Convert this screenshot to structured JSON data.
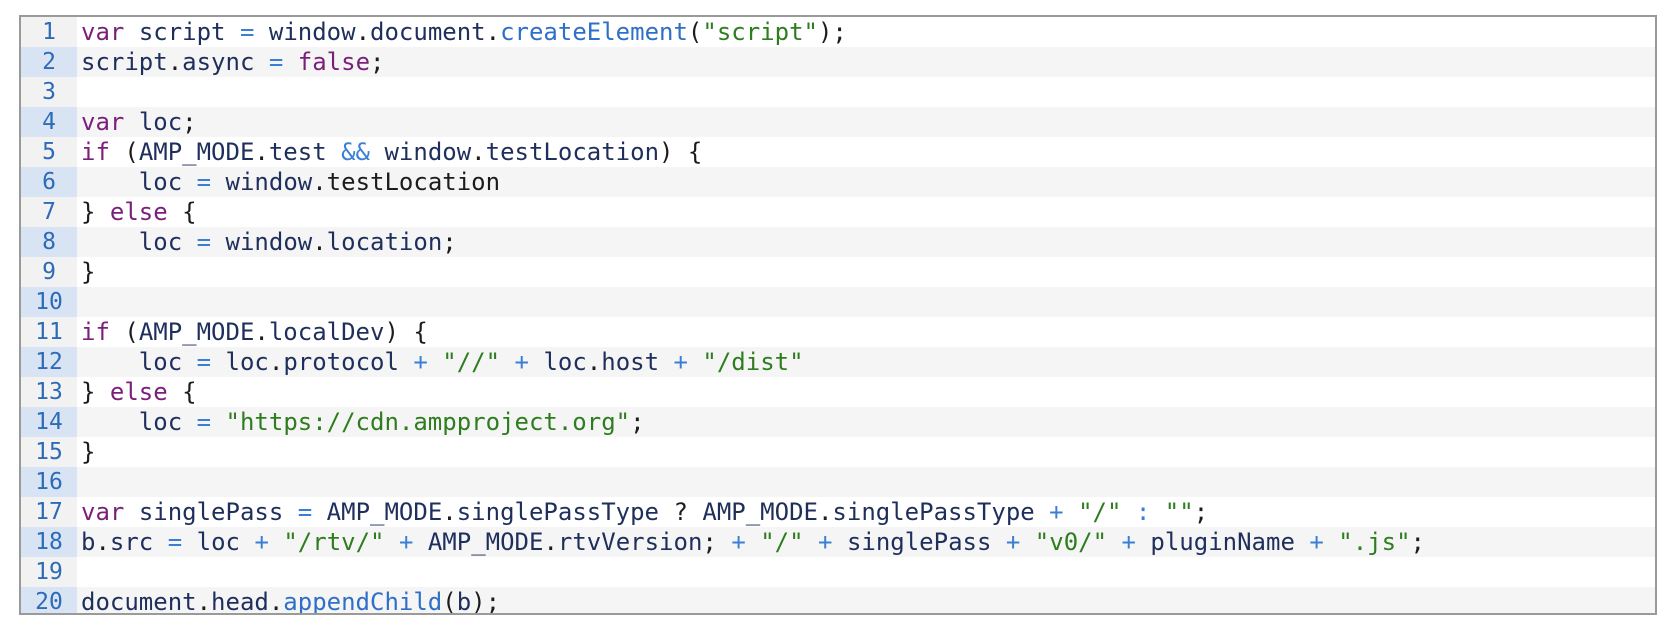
{
  "colors": {
    "keyword": "#7a1f7a",
    "identifier": "#1f2f5c",
    "string": "#2e7d1f",
    "operator": "#3b7fd4",
    "function": "#2f6fc8",
    "punctuation": "#1c1c1c",
    "line_number": "#2d6bb8"
  },
  "lines": [
    {
      "num": "1",
      "tokens": [
        {
          "t": "kw",
          "v": "var"
        },
        {
          "t": "ws",
          "v": " "
        },
        {
          "t": "id",
          "v": "script"
        },
        {
          "t": "ws",
          "v": " "
        },
        {
          "t": "op",
          "v": "="
        },
        {
          "t": "ws",
          "v": " "
        },
        {
          "t": "id",
          "v": "window"
        },
        {
          "t": "pn",
          "v": "."
        },
        {
          "t": "id",
          "v": "document"
        },
        {
          "t": "pn",
          "v": "."
        },
        {
          "t": "fn",
          "v": "createElement"
        },
        {
          "t": "pn",
          "v": "("
        },
        {
          "t": "str",
          "v": "\"script\""
        },
        {
          "t": "pn",
          "v": ");"
        }
      ]
    },
    {
      "num": "2",
      "tokens": [
        {
          "t": "id",
          "v": "script"
        },
        {
          "t": "pn",
          "v": "."
        },
        {
          "t": "id",
          "v": "async"
        },
        {
          "t": "ws",
          "v": " "
        },
        {
          "t": "op",
          "v": "="
        },
        {
          "t": "ws",
          "v": " "
        },
        {
          "t": "kw",
          "v": "false"
        },
        {
          "t": "pn",
          "v": ";"
        }
      ]
    },
    {
      "num": "3",
      "tokens": []
    },
    {
      "num": "4",
      "tokens": [
        {
          "t": "kw",
          "v": "var"
        },
        {
          "t": "ws",
          "v": " "
        },
        {
          "t": "id",
          "v": "loc"
        },
        {
          "t": "pn",
          "v": ";"
        }
      ]
    },
    {
      "num": "5",
      "tokens": [
        {
          "t": "kw",
          "v": "if"
        },
        {
          "t": "ws",
          "v": " "
        },
        {
          "t": "pn",
          "v": "("
        },
        {
          "t": "id",
          "v": "AMP_MODE"
        },
        {
          "t": "pn",
          "v": "."
        },
        {
          "t": "id",
          "v": "test"
        },
        {
          "t": "ws",
          "v": " "
        },
        {
          "t": "op",
          "v": "&&"
        },
        {
          "t": "ws",
          "v": " "
        },
        {
          "t": "id",
          "v": "window"
        },
        {
          "t": "pn",
          "v": "."
        },
        {
          "t": "id",
          "v": "testLocation"
        },
        {
          "t": "pn",
          "v": ")"
        },
        {
          "t": "ws",
          "v": " "
        },
        {
          "t": "pn",
          "v": "{"
        }
      ]
    },
    {
      "num": "6",
      "tokens": [
        {
          "t": "ws",
          "v": "    "
        },
        {
          "t": "id",
          "v": "loc"
        },
        {
          "t": "ws",
          "v": " "
        },
        {
          "t": "op",
          "v": "="
        },
        {
          "t": "ws",
          "v": " "
        },
        {
          "t": "id",
          "v": "window"
        },
        {
          "t": "pn",
          "v": "."
        },
        {
          "t": "pn",
          "v": "testLocation"
        }
      ]
    },
    {
      "num": "7",
      "tokens": [
        {
          "t": "pn",
          "v": "}"
        },
        {
          "t": "ws",
          "v": " "
        },
        {
          "t": "kw",
          "v": "else"
        },
        {
          "t": "ws",
          "v": " "
        },
        {
          "t": "pn",
          "v": "{"
        }
      ]
    },
    {
      "num": "8",
      "tokens": [
        {
          "t": "ws",
          "v": "    "
        },
        {
          "t": "id",
          "v": "loc"
        },
        {
          "t": "ws",
          "v": " "
        },
        {
          "t": "op",
          "v": "="
        },
        {
          "t": "ws",
          "v": " "
        },
        {
          "t": "id",
          "v": "window"
        },
        {
          "t": "pn",
          "v": "."
        },
        {
          "t": "id",
          "v": "location"
        },
        {
          "t": "pn",
          "v": ";"
        }
      ]
    },
    {
      "num": "9",
      "tokens": [
        {
          "t": "pn",
          "v": "}"
        }
      ]
    },
    {
      "num": "10",
      "tokens": []
    },
    {
      "num": "11",
      "tokens": [
        {
          "t": "kw",
          "v": "if"
        },
        {
          "t": "ws",
          "v": " "
        },
        {
          "t": "pn",
          "v": "("
        },
        {
          "t": "id",
          "v": "AMP_MODE"
        },
        {
          "t": "pn",
          "v": "."
        },
        {
          "t": "id",
          "v": "localDev"
        },
        {
          "t": "pn",
          "v": ")"
        },
        {
          "t": "ws",
          "v": " "
        },
        {
          "t": "pn",
          "v": "{"
        }
      ]
    },
    {
      "num": "12",
      "tokens": [
        {
          "t": "ws",
          "v": "    "
        },
        {
          "t": "id",
          "v": "loc"
        },
        {
          "t": "ws",
          "v": " "
        },
        {
          "t": "op",
          "v": "="
        },
        {
          "t": "ws",
          "v": " "
        },
        {
          "t": "id",
          "v": "loc"
        },
        {
          "t": "pn",
          "v": "."
        },
        {
          "t": "id",
          "v": "protocol"
        },
        {
          "t": "ws",
          "v": " "
        },
        {
          "t": "op",
          "v": "+"
        },
        {
          "t": "ws",
          "v": " "
        },
        {
          "t": "str",
          "v": "\"//\""
        },
        {
          "t": "ws",
          "v": " "
        },
        {
          "t": "op",
          "v": "+"
        },
        {
          "t": "ws",
          "v": " "
        },
        {
          "t": "id",
          "v": "loc"
        },
        {
          "t": "pn",
          "v": "."
        },
        {
          "t": "id",
          "v": "host"
        },
        {
          "t": "ws",
          "v": " "
        },
        {
          "t": "op",
          "v": "+"
        },
        {
          "t": "ws",
          "v": " "
        },
        {
          "t": "str",
          "v": "\"/dist\""
        }
      ]
    },
    {
      "num": "13",
      "tokens": [
        {
          "t": "pn",
          "v": "}"
        },
        {
          "t": "ws",
          "v": " "
        },
        {
          "t": "kw",
          "v": "else"
        },
        {
          "t": "ws",
          "v": " "
        },
        {
          "t": "pn",
          "v": "{"
        }
      ]
    },
    {
      "num": "14",
      "tokens": [
        {
          "t": "ws",
          "v": "    "
        },
        {
          "t": "id",
          "v": "loc"
        },
        {
          "t": "ws",
          "v": " "
        },
        {
          "t": "op",
          "v": "="
        },
        {
          "t": "ws",
          "v": " "
        },
        {
          "t": "str",
          "v": "\"https://cdn.ampproject.org\""
        },
        {
          "t": "pn",
          "v": ";"
        }
      ]
    },
    {
      "num": "15",
      "tokens": [
        {
          "t": "pn",
          "v": "}"
        }
      ]
    },
    {
      "num": "16",
      "tokens": []
    },
    {
      "num": "17",
      "tokens": [
        {
          "t": "kw",
          "v": "var"
        },
        {
          "t": "ws",
          "v": " "
        },
        {
          "t": "id",
          "v": "singlePass"
        },
        {
          "t": "ws",
          "v": " "
        },
        {
          "t": "op",
          "v": "="
        },
        {
          "t": "ws",
          "v": " "
        },
        {
          "t": "id",
          "v": "AMP_MODE"
        },
        {
          "t": "pn",
          "v": "."
        },
        {
          "t": "id",
          "v": "singlePassType"
        },
        {
          "t": "ws",
          "v": " "
        },
        {
          "t": "pn",
          "v": "?"
        },
        {
          "t": "ws",
          "v": " "
        },
        {
          "t": "id",
          "v": "AMP_MODE"
        },
        {
          "t": "pn",
          "v": "."
        },
        {
          "t": "id",
          "v": "singlePassType"
        },
        {
          "t": "ws",
          "v": " "
        },
        {
          "t": "op",
          "v": "+"
        },
        {
          "t": "ws",
          "v": " "
        },
        {
          "t": "str",
          "v": "\"/\""
        },
        {
          "t": "ws",
          "v": " "
        },
        {
          "t": "op",
          "v": ":"
        },
        {
          "t": "ws",
          "v": " "
        },
        {
          "t": "str",
          "v": "\"\""
        },
        {
          "t": "pn",
          "v": ";"
        }
      ]
    },
    {
      "num": "18",
      "tokens": [
        {
          "t": "id",
          "v": "b"
        },
        {
          "t": "pn",
          "v": "."
        },
        {
          "t": "id",
          "v": "src"
        },
        {
          "t": "ws",
          "v": " "
        },
        {
          "t": "op",
          "v": "="
        },
        {
          "t": "ws",
          "v": " "
        },
        {
          "t": "id",
          "v": "loc"
        },
        {
          "t": "ws",
          "v": " "
        },
        {
          "t": "op",
          "v": "+"
        },
        {
          "t": "ws",
          "v": " "
        },
        {
          "t": "str",
          "v": "\"/rtv/\""
        },
        {
          "t": "ws",
          "v": " "
        },
        {
          "t": "op",
          "v": "+"
        },
        {
          "t": "ws",
          "v": " "
        },
        {
          "t": "id",
          "v": "AMP_MODE"
        },
        {
          "t": "pn",
          "v": "."
        },
        {
          "t": "id",
          "v": "rtvVersion"
        },
        {
          "t": "pn",
          "v": ";"
        },
        {
          "t": "ws",
          "v": " "
        },
        {
          "t": "op",
          "v": "+"
        },
        {
          "t": "ws",
          "v": " "
        },
        {
          "t": "str",
          "v": "\"/\""
        },
        {
          "t": "ws",
          "v": " "
        },
        {
          "t": "op",
          "v": "+"
        },
        {
          "t": "ws",
          "v": " "
        },
        {
          "t": "id",
          "v": "singlePass"
        },
        {
          "t": "ws",
          "v": " "
        },
        {
          "t": "op",
          "v": "+"
        },
        {
          "t": "ws",
          "v": " "
        },
        {
          "t": "str",
          "v": "\"v0/\""
        },
        {
          "t": "ws",
          "v": " "
        },
        {
          "t": "op",
          "v": "+"
        },
        {
          "t": "ws",
          "v": " "
        },
        {
          "t": "id",
          "v": "pluginName"
        },
        {
          "t": "ws",
          "v": " "
        },
        {
          "t": "op",
          "v": "+"
        },
        {
          "t": "ws",
          "v": " "
        },
        {
          "t": "str",
          "v": "\".js\""
        },
        {
          "t": "pn",
          "v": ";"
        }
      ]
    },
    {
      "num": "19",
      "tokens": []
    },
    {
      "num": "20",
      "tokens": [
        {
          "t": "id",
          "v": "document"
        },
        {
          "t": "pn",
          "v": "."
        },
        {
          "t": "id",
          "v": "head"
        },
        {
          "t": "pn",
          "v": "."
        },
        {
          "t": "fn",
          "v": "appendChild"
        },
        {
          "t": "pn",
          "v": "("
        },
        {
          "t": "id",
          "v": "b"
        },
        {
          "t": "pn",
          "v": ");"
        }
      ]
    }
  ]
}
